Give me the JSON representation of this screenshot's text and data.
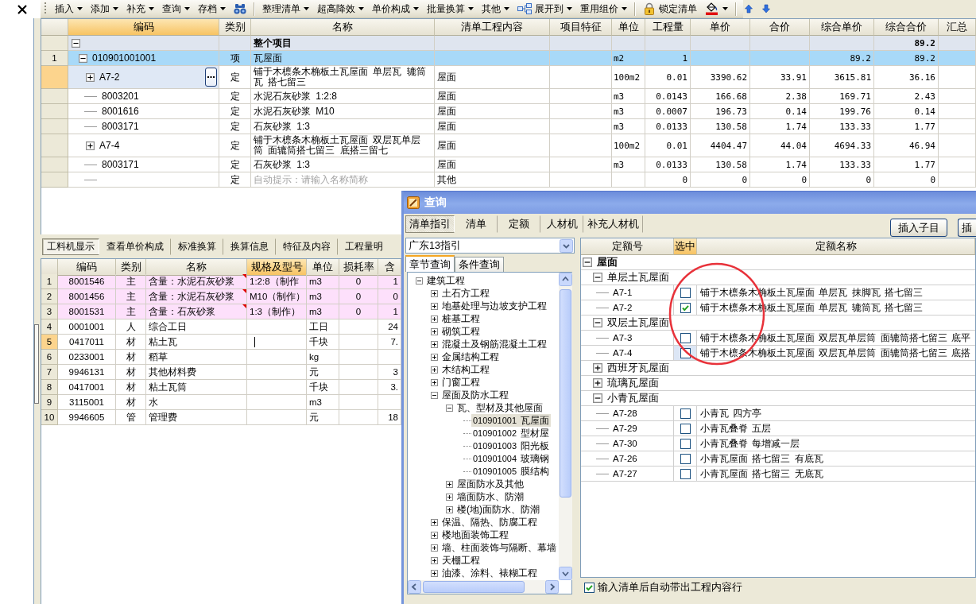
{
  "toolbar": [
    {
      "kind": "menu",
      "label": "插入"
    },
    {
      "kind": "menu",
      "label": "添加"
    },
    {
      "kind": "menu",
      "label": "补充"
    },
    {
      "kind": "menu",
      "label": "查询"
    },
    {
      "kind": "menu",
      "label": "存档"
    },
    {
      "kind": "find"
    },
    {
      "kind": "separator"
    },
    {
      "kind": "menu",
      "label": "整理清单"
    },
    {
      "kind": "menu",
      "label": "超高降效"
    },
    {
      "kind": "menu",
      "label": "单价构成"
    },
    {
      "kind": "menu",
      "label": "批量换算"
    },
    {
      "kind": "menu",
      "label": "其他"
    },
    {
      "kind": "expand",
      "label": "展开到"
    },
    {
      "kind": "menu",
      "label": "重用组价"
    },
    {
      "kind": "separator"
    },
    {
      "kind": "lock",
      "label": "锁定清单"
    },
    {
      "kind": "fill"
    },
    {
      "kind": "separator"
    },
    {
      "kind": "up"
    },
    {
      "kind": "down"
    }
  ],
  "bill_table": {
    "columns": [
      {
        "label": "编码",
        "selected": true
      },
      {
        "label": "类别",
        "selected": false
      },
      {
        "label": "名称",
        "selected": false
      },
      {
        "label": "清单工程内容",
        "selected": false
      },
      {
        "label": "项目特征",
        "selected": false
      },
      {
        "label": "单位",
        "selected": false
      },
      {
        "label": "工程量",
        "selected": false
      },
      {
        "label": "单价",
        "selected": false
      },
      {
        "label": "合价",
        "selected": false
      },
      {
        "label": "综合单价",
        "selected": false
      },
      {
        "label": "综合合价",
        "selected": false
      },
      {
        "label": "汇总",
        "selected": false
      }
    ],
    "rows": [
      {
        "kind": "project",
        "name": "整个项目",
        "comp_amount": "89.2",
        "expanded": true,
        "selected": false,
        "children": [
          {
            "kind": "bill",
            "number": "1",
            "code": "010901001001",
            "type": "项",
            "name": "瓦屋面",
            "unit": "m2",
            "quantity": "1",
            "comp_price": "89.2",
            "comp_amount": "89.2",
            "expanded": true,
            "selected": false,
            "children": [
              {
                "kind": "quota",
                "code": "A7-2",
                "type": "定",
                "name": "铺于木檩条木桷板土瓦屋面 单层瓦 辘筒瓦 搭七留三",
                "content": "屋面",
                "unit": "100m2",
                "quantity": "0.01",
                "price": "3390.62",
                "amount": "33.91",
                "comp_price": "3615.81",
                "comp_amount": "36.16",
                "expanded": false,
                "selected": true
              },
              {
                "kind": "material",
                "code": "8003201",
                "type": "定",
                "name": "水泥石灰砂浆 1:2:8",
                "content": "屋面",
                "unit": "m3",
                "quantity": "0.0143",
                "price": "166.68",
                "amount": "2.38",
                "comp_price": "169.71",
                "comp_amount": "2.43",
                "selected": false
              },
              {
                "kind": "material",
                "code": "8001616",
                "type": "定",
                "name": "水泥石灰砂浆 M10",
                "content": "屋面",
                "unit": "m3",
                "quantity": "0.0007",
                "price": "196.73",
                "amount": "0.14",
                "comp_price": "199.76",
                "comp_amount": "0.14",
                "selected": false
              },
              {
                "kind": "material",
                "code": "8003171",
                "type": "定",
                "name": "石灰砂浆 1:3",
                "content": "屋面",
                "unit": "m3",
                "quantity": "0.0133",
                "price": "130.58",
                "amount": "1.74",
                "comp_price": "133.33",
                "comp_amount": "1.77",
                "selected": false
              },
              {
                "kind": "quota",
                "code": "A7-4",
                "type": "定",
                "name": "铺于木檩条木桷板土瓦屋面 双层瓦单层筒 面辘筒搭七留三 底搭三留七",
                "content": "屋面",
                "unit": "100m2",
                "quantity": "0.01",
                "price": "4404.47",
                "amount": "44.04",
                "comp_price": "4694.33",
                "comp_amount": "46.94",
                "expanded": false,
                "selected": false
              },
              {
                "kind": "material",
                "code": "8003171",
                "type": "定",
                "name": "石灰砂浆 1:3",
                "content": "屋面",
                "unit": "m3",
                "quantity": "0.0133",
                "price": "130.58",
                "amount": "1.74",
                "comp_price": "133.33",
                "comp_amount": "1.77",
                "selected": false
              },
              {
                "kind": "blank",
                "type": "定",
                "placeholder": "自动提示：请输入名称简称",
                "content": "其他",
                "quantity": "0",
                "price": "0",
                "amount": "0",
                "comp_price": "0",
                "comp_amount": "0",
                "selected": false
              }
            ]
          }
        ]
      }
    ]
  },
  "detail_panel": {
    "tabs": [
      {
        "label": "工料机显示",
        "selected": true
      },
      {
        "label": "查看单价构成",
        "selected": false
      },
      {
        "label": "标准换算",
        "selected": false
      },
      {
        "label": "换算信息",
        "selected": false
      },
      {
        "label": "特征及内容",
        "selected": false
      },
      {
        "label": "工程量明",
        "selected": false
      }
    ],
    "table": {
      "columns": [
        {
          "label": "编码",
          "selected": false
        },
        {
          "label": "类别",
          "selected": false
        },
        {
          "label": "名称",
          "selected": false
        },
        {
          "label": "规格及型号",
          "selected": true
        },
        {
          "label": "单位",
          "selected": false
        },
        {
          "label": "损耗率",
          "selected": false
        },
        {
          "label": "含",
          "selected": false
        }
      ],
      "rows": [
        {
          "number": "1",
          "code": "8001546",
          "type": "主",
          "name": "含量：水泥石灰砂浆",
          "spec": "1:2:8（制作",
          "unit": "m3",
          "loss": "0",
          "content": "1",
          "edited": true,
          "selected": false
        },
        {
          "number": "2",
          "code": "8001456",
          "type": "主",
          "name": "含量：水泥石灰砂浆",
          "spec": "M10（制作）",
          "unit": "m3",
          "loss": "0",
          "content": "0",
          "edited": true,
          "selected": false
        },
        {
          "number": "3",
          "code": "8001531",
          "type": "主",
          "name": "含量：石灰砂浆",
          "spec": "1:3（制作）",
          "unit": "m3",
          "loss": "0",
          "content": "1",
          "edited": true,
          "selected": false
        },
        {
          "number": "4",
          "code": "0001001",
          "type": "人",
          "name": "综合工日",
          "unit": "工日",
          "content": "24",
          "edited": false,
          "selected": false
        },
        {
          "number": "5",
          "code": "0417011",
          "type": "材",
          "name": "粘土瓦",
          "unit": "千块",
          "content": "7.",
          "edited": false,
          "selected": true
        },
        {
          "number": "6",
          "code": "0233001",
          "type": "材",
          "name": "稻草",
          "unit": "kg",
          "edited": false,
          "selected": false
        },
        {
          "number": "7",
          "code": "9946131",
          "type": "材",
          "name": "其他材料费",
          "unit": "元",
          "content": "3",
          "edited": false,
          "selected": false
        },
        {
          "number": "8",
          "code": "0417001",
          "type": "材",
          "name": "粘土瓦筒",
          "unit": "千块",
          "content": "3.",
          "edited": false,
          "selected": false
        },
        {
          "number": "9",
          "code": "3115001",
          "type": "材",
          "name": "水",
          "unit": "m3",
          "edited": false,
          "selected": false
        },
        {
          "number": "10",
          "code": "9946605",
          "type": "管",
          "name": "管理费",
          "unit": "元",
          "content": "18",
          "edited": false,
          "selected": false
        }
      ]
    }
  },
  "query_dialog": {
    "title": "查询",
    "tabs": [
      {
        "label": "清单指引",
        "selected": true
      },
      {
        "label": "清单",
        "selected": false
      },
      {
        "label": "定额",
        "selected": false
      },
      {
        "label": "人材机",
        "selected": false
      },
      {
        "label": "补充人材机",
        "selected": false
      }
    ],
    "buttons": [
      "插入子目",
      "插"
    ],
    "guide": {
      "value": "广东13指引"
    },
    "search_tabs": [
      {
        "label": "章节查询",
        "selected": true
      },
      {
        "label": "条件查询",
        "selected": false
      }
    ],
    "tree": [
      {
        "label": "建筑工程",
        "expanded": true,
        "selected": false,
        "children": [
          {
            "label": "土石方工程",
            "expanded": false,
            "selected": false
          },
          {
            "label": "地基处理与边坡支护工程",
            "expanded": false,
            "selected": false
          },
          {
            "label": "桩基工程",
            "expanded": false,
            "selected": false
          },
          {
            "label": "砌筑工程",
            "expanded": false,
            "selected": false
          },
          {
            "label": "混凝土及钢筋混凝土工程",
            "expanded": false,
            "selected": false
          },
          {
            "label": "金属结构工程",
            "expanded": false,
            "selected": false
          },
          {
            "label": "木结构工程",
            "expanded": false,
            "selected": false
          },
          {
            "label": "门窗工程",
            "expanded": false,
            "selected": false
          },
          {
            "label": "屋面及防水工程",
            "expanded": true,
            "selected": false,
            "children": [
              {
                "label": "瓦、型材及其他屋面",
                "expanded": true,
                "selected": false,
                "children": [
                  {
                    "code": "010901001",
                    "label": "瓦屋面",
                    "selected": true
                  },
                  {
                    "code": "010901002",
                    "label": "型材屋",
                    "selected": false
                  },
                  {
                    "code": "010901003",
                    "label": "阳光板",
                    "selected": false
                  },
                  {
                    "code": "010901004",
                    "label": "玻璃钢",
                    "selected": false
                  },
                  {
                    "code": "010901005",
                    "label": "膜结构",
                    "selected": false
                  }
                ]
              },
              {
                "label": "屋面防水及其他",
                "expanded": false,
                "selected": false
              },
              {
                "label": "墙面防水、防潮",
                "expanded": false,
                "selected": false
              },
              {
                "label": "楼(地)面防水、防潮",
                "expanded": false,
                "selected": false
              }
            ]
          },
          {
            "label": "保温、隔热、防腐工程",
            "expanded": false,
            "selected": false
          },
          {
            "label": "楼地面装饰工程",
            "expanded": false,
            "selected": false
          },
          {
            "label": "墙、柱面装饰与隔断、幕墙",
            "expanded": false,
            "selected": false
          },
          {
            "label": "天棚工程",
            "expanded": false,
            "selected": false
          },
          {
            "label": "油漆、涂料、裱糊工程",
            "expanded": false,
            "selected": false
          }
        ]
      }
    ],
    "quota_table": {
      "columns": [
        {
          "label": "定额号",
          "selected": false
        },
        {
          "label": "选中",
          "selected": true
        },
        {
          "label": "定额名称",
          "selected": false
        }
      ],
      "rows": [
        {
          "kind": "group",
          "label": "屋面",
          "expanded": true,
          "children": [
            {
              "kind": "group",
              "label": "单层土瓦屋面",
              "expanded": true,
              "children": [
                {
                  "kind": "quota",
                  "code": "A7-1",
                  "checked": false,
                  "selected": false,
                  "name": "铺于木檩条木桷板土瓦屋面 单层瓦 抹脚瓦 搭七留三"
                },
                {
                  "kind": "quota",
                  "code": "A7-2",
                  "checked": true,
                  "selected": false,
                  "name": "铺于木檩条木桷板土瓦屋面 单层瓦 辘筒瓦 搭七留三"
                }
              ]
            },
            {
              "kind": "group",
              "label": "双层土瓦屋面",
              "expanded": true,
              "children": [
                {
                  "kind": "quota",
                  "code": "A7-3",
                  "checked": false,
                  "selected": false,
                  "name": "铺于木檩条木桷板土瓦屋面 双层瓦单层筒 面辘筒搭七留三 底平"
                },
                {
                  "kind": "quota",
                  "code": "A7-4",
                  "checked": false,
                  "selected": true,
                  "name": "铺于木檩条木桷板土瓦屋面 双层瓦单层筒 面辘筒搭七留三 底搭"
                }
              ]
            },
            {
              "kind": "group",
              "label": "西班牙瓦屋面",
              "expanded": false
            },
            {
              "kind": "group",
              "label": "琉璃瓦屋面",
              "expanded": false
            },
            {
              "kind": "group",
              "label": "小青瓦屋面",
              "expanded": true,
              "children": [
                {
                  "kind": "quota",
                  "code": "A7-28",
                  "checked": false,
                  "selected": false,
                  "name": "小青瓦 四方亭"
                },
                {
                  "kind": "quota",
                  "code": "A7-29",
                  "checked": false,
                  "selected": false,
                  "name": "小青瓦叠脊 五层"
                },
                {
                  "kind": "quota",
                  "code": "A7-30",
                  "checked": false,
                  "selected": false,
                  "name": "小青瓦叠脊 每增减一层"
                },
                {
                  "kind": "quota",
                  "code": "A7-26",
                  "checked": false,
                  "selected": false,
                  "name": "小青瓦屋面 搭七留三 有底瓦"
                },
                {
                  "kind": "quota",
                  "code": "A7-27",
                  "checked": false,
                  "selected": false,
                  "name": "小青瓦屋面 搭七留三 无底瓦"
                }
              ]
            }
          ]
        }
      ]
    },
    "auto_content": {
      "label": "输入清单后自动带出工程内容行",
      "checked": true
    }
  },
  "annotations": [
    {
      "kind": "ellipse"
    }
  ]
}
